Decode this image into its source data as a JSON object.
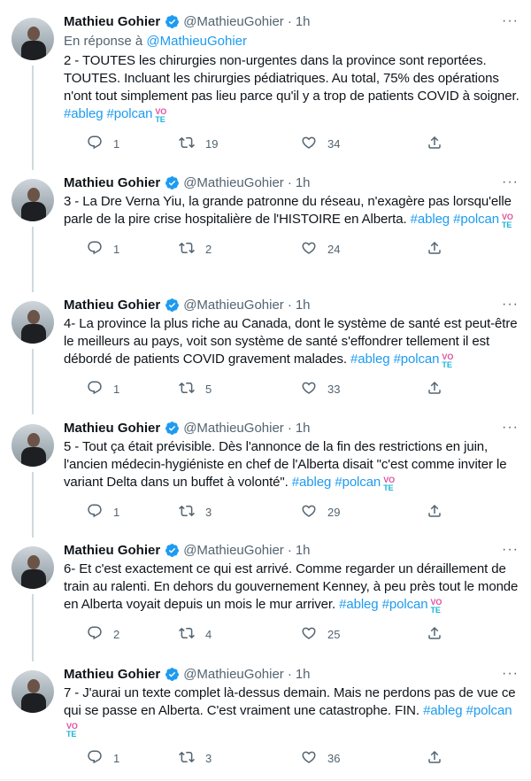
{
  "author": {
    "name": "Mathieu Gohier",
    "handle": "@MathieuGohier",
    "separator": "·"
  },
  "reply_prefix": "En réponse à",
  "reply_to": "@MathieuGohier",
  "more_label": "···",
  "vote_top": "VO",
  "vote_bottom": "TE",
  "tweets": [
    {
      "time": "1h",
      "has_reply": true,
      "text": "2 - TOUTES les chirurgies non-urgentes dans la province sont reportées. TOUTES. Incluant les chirurgies pédiatriques. Au total, 75% des opérations n'ont tout simplement pas lieu parce qu'il y a trop de patients COVID à soigner.",
      "tags": [
        "#ableg",
        "#polcan"
      ],
      "replies": "1",
      "retweets": "19",
      "likes": "34"
    },
    {
      "time": "1h",
      "has_reply": false,
      "text": "3 - La Dre Verna Yiu, la grande patronne du réseau, n'exagère pas lorsqu'elle parle de la pire crise hospitalière de l'HISTOIRE en Alberta.",
      "tags": [
        "#ableg",
        "#polcan"
      ],
      "replies": "1",
      "retweets": "2",
      "likes": "24"
    },
    {
      "time": "1h",
      "has_reply": false,
      "text": "4- La province la plus riche au Canada, dont le système de santé est peut-être le meilleurs au pays, voit son système de santé s'effondrer tellement il est débordé de patients COVID gravement malades.",
      "tags": [
        "#ableg",
        "#polcan"
      ],
      "replies": "1",
      "retweets": "5",
      "likes": "33"
    },
    {
      "time": "1h",
      "has_reply": false,
      "text": "5 - Tout ça était prévisible. Dès l'annonce de la fin des restrictions en juin, l'ancien médecin-hygiéniste en chef de l'Alberta disait \"c'est comme inviter le variant Delta dans un buffet à volonté\".",
      "tags": [
        "#ableg",
        "#polcan"
      ],
      "replies": "1",
      "retweets": "3",
      "likes": "29"
    },
    {
      "time": "1h",
      "has_reply": false,
      "text": "6- Et c'est exactement ce qui est arrivé. Comme regarder un déraillement de train au ralenti. En dehors du gouvernement Kenney, à peu près tout le monde en Alberta voyait depuis un mois le mur arriver.",
      "tags": [
        "#ableg",
        "#polcan"
      ],
      "replies": "2",
      "retweets": "4",
      "likes": "25"
    },
    {
      "time": "1h",
      "has_reply": false,
      "text": "7 - J'aurai un texte complet là-dessus demain. Mais ne perdons pas de vue ce qui se passe en Alberta. C'est vraiment une catastrophe. FIN.",
      "tags": [
        "#ableg",
        "#polcan"
      ],
      "replies": "1",
      "retweets": "3",
      "likes": "36"
    }
  ]
}
